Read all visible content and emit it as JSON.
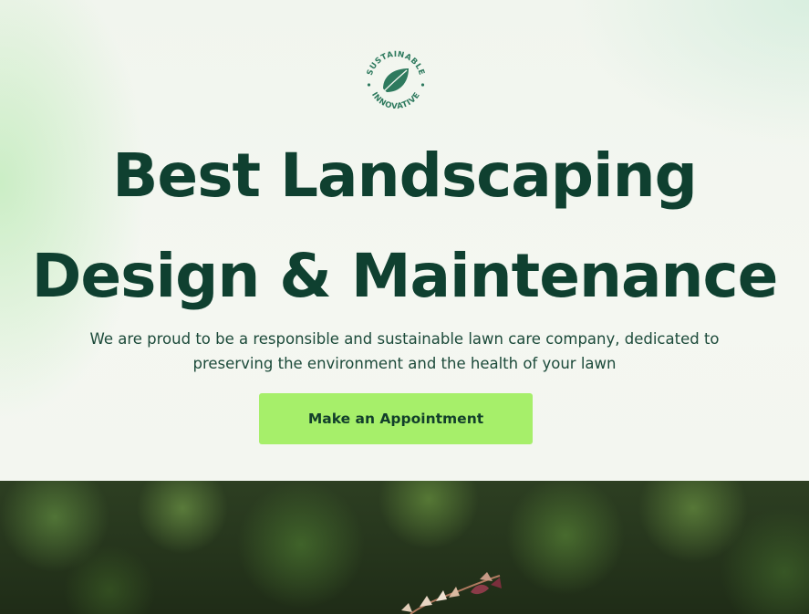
{
  "seal": {
    "text_top": "SUSTAINABLE",
    "text_bottom": "INNOVATIVE"
  },
  "hero": {
    "headline_line1": "Best Landscaping",
    "headline_line2": "Design & Maintenance",
    "subtext": "We are proud to be a responsible and sustainable lawn care company, dedicated to preserving the environment and the health of your lawn",
    "cta_label": "Make an Appointment"
  },
  "colors": {
    "heading": "#0f4030",
    "cta_background": "#a6ef6a",
    "seal": "#2e7a5e"
  },
  "icons": {
    "seal_leaf": "leaf-icon"
  }
}
